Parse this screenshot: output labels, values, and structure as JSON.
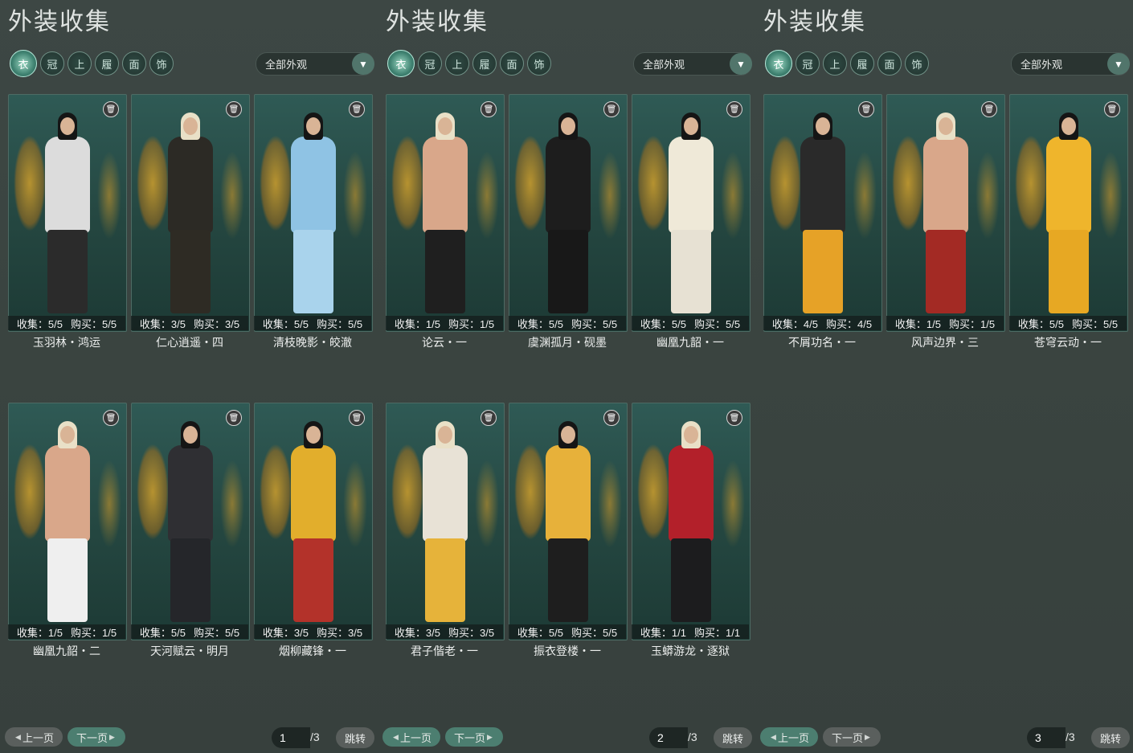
{
  "panels": [
    {
      "title": "外装收集",
      "filter_label": "全部外观",
      "cards": [
        {
          "stats_collect": "收集：5/5",
          "stats_buy": "购买：5/5",
          "name": "玉羽林・鸿运"
        },
        {
          "stats_collect": "收集：3/5",
          "stats_buy": "购买：3/5",
          "name": "仁心逍遥・四"
        },
        {
          "stats_collect": "收集：5/5",
          "stats_buy": "购买：5/5",
          "name": "清枝晚影・皎澈"
        },
        {
          "stats_collect": "收集：1/5",
          "stats_buy": "购买：1/5",
          "name": "幽凰九韶・二"
        },
        {
          "stats_collect": "收集：5/5",
          "stats_buy": "购买：5/5",
          "name": "天河赋云・明月"
        },
        {
          "stats_collect": "收集：3/5",
          "stats_buy": "购买：3/5",
          "name": "烟柳藏锋・一"
        }
      ],
      "pager": {
        "prev": "上一页",
        "next": "下一页",
        "page": "1",
        "total": "/3",
        "jump": "跳转"
      }
    },
    {
      "title": "外装收集",
      "filter_label": "全部外观",
      "cards": [
        {
          "stats_collect": "收集：1/5",
          "stats_buy": "购买：1/5",
          "name": "论云・一"
        },
        {
          "stats_collect": "收集：5/5",
          "stats_buy": "购买：5/5",
          "name": "虞渊孤月・砚墨"
        },
        {
          "stats_collect": "收集：5/5",
          "stats_buy": "购买：5/5",
          "name": "幽凰九韶・一"
        },
        {
          "stats_collect": "收集：3/5",
          "stats_buy": "购买：3/5",
          "name": "君子偕老・一"
        },
        {
          "stats_collect": "收集：5/5",
          "stats_buy": "购买：5/5",
          "name": "振衣登楼・一"
        },
        {
          "stats_collect": "收集：1/1",
          "stats_buy": "购买：1/1",
          "name": "玉蟒游龙・逐狱"
        }
      ],
      "pager": {
        "prev": "上一页",
        "next": "下一页",
        "page": "2",
        "total": "/3",
        "jump": "跳转"
      }
    },
    {
      "title": "外装收集",
      "filter_label": "全部外观",
      "cards": [
        {
          "stats_collect": "收集：4/5",
          "stats_buy": "购买：4/5",
          "name": "不屑功名・一"
        },
        {
          "stats_collect": "收集：1/5",
          "stats_buy": "购买：1/5",
          "name": "风声边界・三"
        },
        {
          "stats_collect": "收集：5/5",
          "stats_buy": "购买：5/5",
          "name": "苍穹云动・一"
        }
      ],
      "pager": {
        "prev": "上一页",
        "next": "下一页",
        "page": "3",
        "total": "/3",
        "jump": "跳转"
      }
    }
  ],
  "category_icons": [
    "outfit-icon",
    "hat-icon",
    "top-icon",
    "shoes-icon",
    "mask-icon",
    "accessory-icon"
  ],
  "colors": {
    "accent": "#4c7e70",
    "card_bg": "#244640",
    "outfit_palette": [
      "#d9d9d9",
      "#2b2b2b",
      "#8fc3e4",
      "#cfb88a",
      "#1d1d1d",
      "#f1f1f1",
      "#e6a227",
      "#d69a26",
      "#efb52c",
      "#e8e2d6",
      "#2f2f33",
      "#e2ae2c",
      "#f0f0f0",
      "#e7b13a",
      "#1c1c1e"
    ]
  }
}
